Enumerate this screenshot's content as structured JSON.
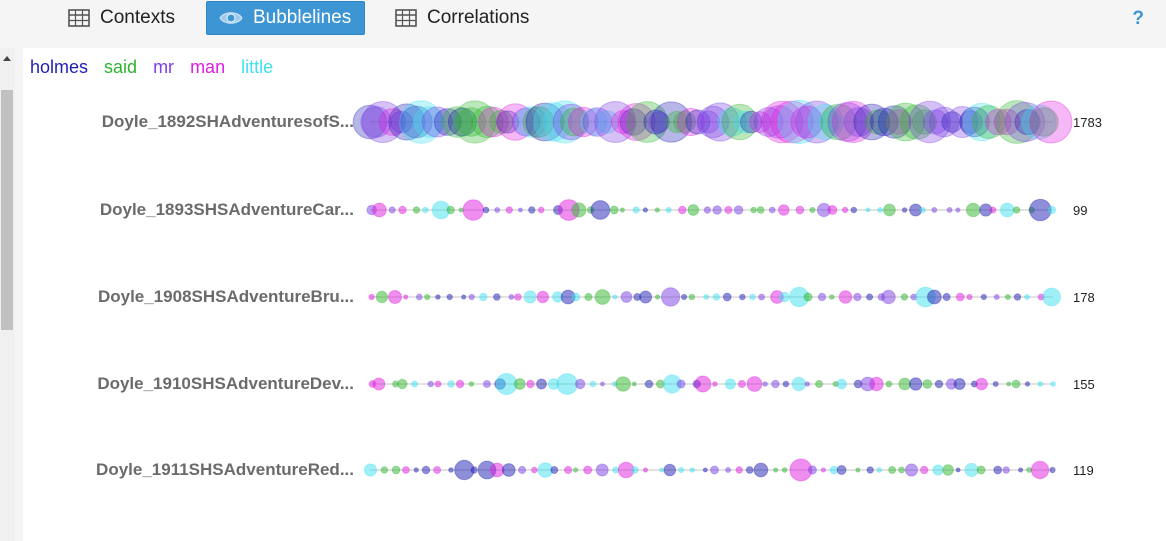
{
  "tabs": [
    {
      "label": "Contexts",
      "icon": "table-icon",
      "active": false
    },
    {
      "label": "Bubblelines",
      "icon": "eye-icon",
      "active": true
    },
    {
      "label": "Correlations",
      "icon": "table-icon",
      "active": false
    }
  ],
  "help_label": "?",
  "legend": [
    {
      "term": "holmes",
      "color": "#1f1fb4"
    },
    {
      "term": "said",
      "color": "#2db52d"
    },
    {
      "term": "mr",
      "color": "#7b3fe4"
    },
    {
      "term": "man",
      "color": "#e01ee0"
    },
    {
      "term": "little",
      "color": "#3fe0f0"
    }
  ],
  "chart_data": {
    "type": "scatter",
    "documents": [
      {
        "label": "Doyle_1892SHAdventuresofS...",
        "count": 1783
      },
      {
        "label": "Doyle_1893SHSAdventureCar...",
        "count": 99
      },
      {
        "label": "Doyle_1908SHSAdventureBru...",
        "count": 178
      },
      {
        "label": "Doyle_1910SHSAdventureDev...",
        "count": 155
      },
      {
        "label": "Doyle_1911SHSAdventureRed...",
        "count": 119
      }
    ]
  }
}
